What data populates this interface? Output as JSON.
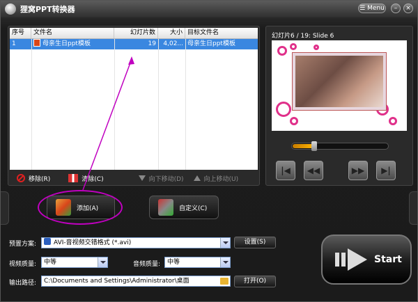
{
  "window": {
    "title": "狸窝PPT转换器",
    "menu_label": "Menu"
  },
  "table": {
    "headers": [
      "序号",
      "文件名",
      "幻灯片数",
      "大小",
      "目标文件名"
    ],
    "rows": [
      {
        "index": "1",
        "filename": "母亲生日ppt模板",
        "slides": "19",
        "size": "4,02...",
        "target": "母亲生日ppt模板",
        "selected": true
      }
    ]
  },
  "list_toolbar": {
    "remove": "移除(R)",
    "clear": "清除(C)",
    "move_down": "向下移动(D)",
    "move_up": "向上移动(U)"
  },
  "preview": {
    "slide_info": "幻灯片6 / 19: Slide 6",
    "progress_fraction": 0.22
  },
  "buttons": {
    "add": "添加(A)",
    "custom": "自定义(C)",
    "start": "Start"
  },
  "settings": {
    "preset_label": "预置方案:",
    "preset_value": "AVI-音视频交错格式 (*.avi)",
    "settings_button": "设置(S)",
    "video_quality_label": "视频质量:",
    "video_quality_value": "中等",
    "audio_quality_label": "音频质量:",
    "audio_quality_value": "中等",
    "output_path_label": "输出路径:",
    "output_path_value": "C:\\Documents and Settings\\Administrator\\桌面",
    "open_button": "打开(O)"
  },
  "colors": {
    "selection": "#3a87e0",
    "accent_pink": "#e0308a",
    "annotation": "#c000c0"
  }
}
